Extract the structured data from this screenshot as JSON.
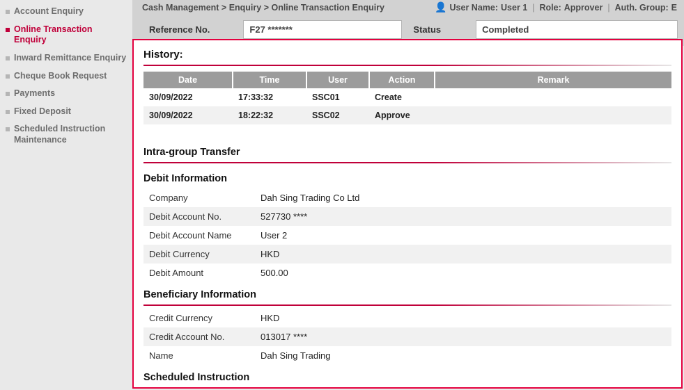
{
  "sidebar": {
    "items": [
      {
        "label": "Account Enquiry"
      },
      {
        "label": "Online Transaction Enquiry"
      },
      {
        "label": "Inward Remittance Enquiry"
      },
      {
        "label": "Cheque Book Request"
      },
      {
        "label": "Payments"
      },
      {
        "label": "Fixed Deposit"
      },
      {
        "label": "Scheduled Instruction Maintenance"
      }
    ]
  },
  "header": {
    "breadcrumb": "Cash Management > Enquiry > Online Transaction Enquiry",
    "user_label": "User Name:",
    "user_value": "User 1",
    "role_label": "Role:",
    "role_value": "Approver",
    "auth_label": "Auth. Group:",
    "auth_value": "E"
  },
  "filter": {
    "ref_label": "Reference No.",
    "ref_value": "F27 *******",
    "status_label": "Status",
    "status_value": "Completed"
  },
  "panel": {
    "history_title": "History:",
    "history": {
      "cols": [
        "Date",
        "Time",
        "User",
        "Action",
        "Remark"
      ],
      "rows": [
        {
          "date": "30/09/2022",
          "time": "17:33:32",
          "user": "SSC01",
          "action": "Create",
          "remark": ""
        },
        {
          "date": "30/09/2022",
          "time": "18:22:32",
          "user": "SSC02",
          "action": "Approve",
          "remark": ""
        }
      ]
    },
    "section_title": "Intra-group Transfer",
    "debit_title": "Debit Information",
    "debit": {
      "company_label": "Company",
      "company_value": "Dah Sing Trading Co Ltd",
      "acct_label": "Debit Account No.",
      "acct_value": "527730 ****",
      "name_label": "Debit Account Name",
      "name_value": "User 2",
      "ccy_label": "Debit Currency",
      "ccy_value": "HKD",
      "amt_label": "Debit Amount",
      "amt_value": "500.00"
    },
    "bene_title": "Beneficiary Information",
    "bene": {
      "ccy_label": "Credit Currency",
      "ccy_value": "HKD",
      "acct_label": "Credit Account No.",
      "acct_value": "013017 ****",
      "name_label": "Name",
      "name_value": "Dah Sing Trading"
    },
    "sched_title": "Scheduled Instruction"
  }
}
